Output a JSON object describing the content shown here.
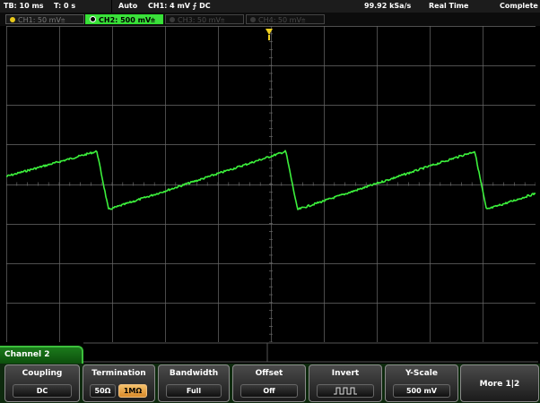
{
  "status": {
    "timebase": "TB: 10 ms",
    "trigger_time": "T: 0 s",
    "mode": "Auto",
    "trigger_info": "CH1: 4 mV ⨍ DC",
    "sample_rate": "99.92 kSa/s",
    "acq_mode": "Real Time",
    "acq_state": "Complete"
  },
  "channels": [
    {
      "label": "CH1: 50 mV⩧",
      "color": "#e8c81a",
      "active": false
    },
    {
      "label": "CH2: 500 mV⩧",
      "color": "#2fe02f",
      "active": true
    },
    {
      "label": "CH3: 50 mV⩧",
      "color": "#5a5a5a",
      "active": false
    },
    {
      "label": "CH4: 50 mV⩧",
      "color": "#5a5a5a",
      "active": false
    }
  ],
  "menu": {
    "channel_title": "Channel 2",
    "coupling": {
      "title": "Coupling",
      "value": "DC"
    },
    "termination": {
      "title": "Termination",
      "opt_50": "50Ω",
      "opt_1m": "1MΩ",
      "selected": "1MΩ"
    },
    "bandwidth": {
      "title": "Bandwidth",
      "value": "Full"
    },
    "offset": {
      "title": "Offset",
      "value": "Off"
    },
    "invert": {
      "title": "Invert",
      "icon": "invert-waveform-icon"
    },
    "yscale": {
      "title": "Y-Scale",
      "value": "500 mV"
    },
    "more": "More 1|2"
  },
  "colors": {
    "trace": "#3cf03c",
    "trigger_marker": "#f0d020",
    "grid": "#6a6a6a",
    "accent": "#e8a83a"
  }
}
